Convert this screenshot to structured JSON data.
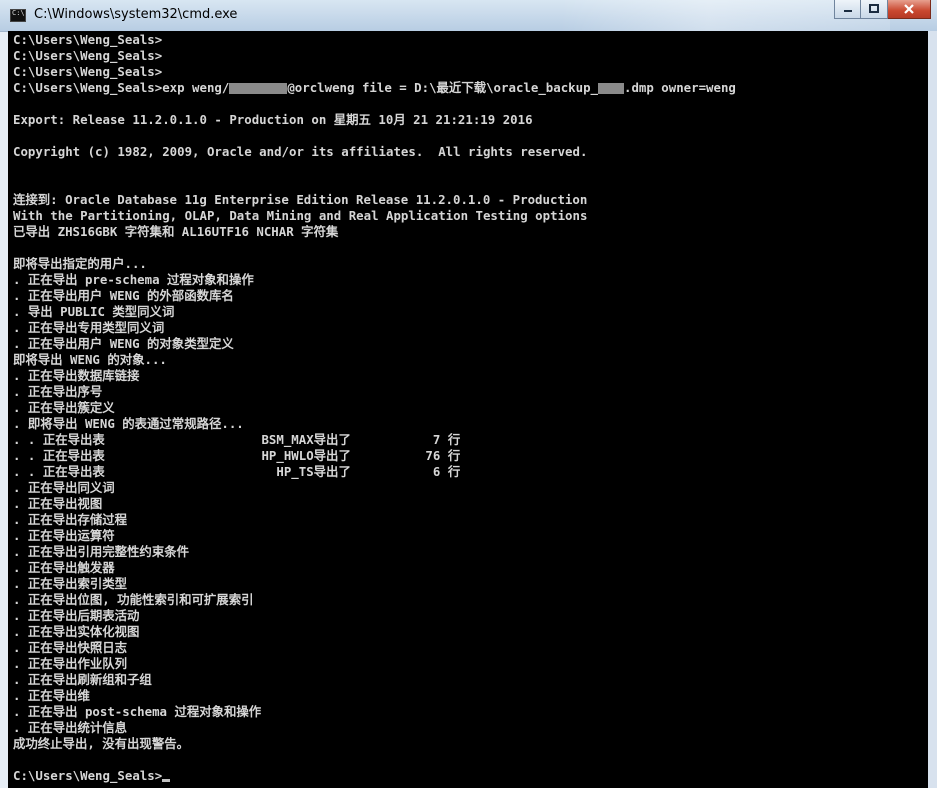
{
  "window": {
    "title": "C:\\Windows\\system32\\cmd.exe",
    "controls": {
      "minimize_icon": "minimize-icon",
      "maximize_icon": "maximize-icon",
      "close_icon": "close-icon"
    }
  },
  "console": {
    "prompt": "C:\\Users\\Weng_Seals>",
    "lines": [
      "C:\\Users\\Weng_Seals>",
      "C:\\Users\\Weng_Seals>",
      "C:\\Users\\Weng_Seals>",
      "C:\\Users\\Weng_Seals>exp weng/",
      "",
      "Export: Release 11.2.0.1.0 - Production on 星期五 10月 21 21:21:19 2016",
      "",
      "Copyright (c) 1982, 2009, Oracle and/or its affiliates.  All rights reserved.",
      "",
      "",
      "连接到: Oracle Database 11g Enterprise Edition Release 11.2.0.1.0 - Production",
      "With the Partitioning, OLAP, Data Mining and Real Application Testing options",
      "已导出 ZHS16GBK 字符集和 AL16UTF16 NCHAR 字符集",
      "",
      "即将导出指定的用户...",
      ". 正在导出 pre-schema 过程对象和操作",
      ". 正在导出用户 WENG 的外部函数库名",
      ". 导出 PUBLIC 类型同义词",
      ". 正在导出专用类型同义词",
      ". 正在导出用户 WENG 的对象类型定义",
      "即将导出 WENG 的对象...",
      ". 正在导出数据库链接",
      ". 正在导出序号",
      ". 正在导出簇定义",
      ". 即将导出 WENG 的表通过常规路径...",
      ". . 正在导出表                     BSM_MAX导出了           7 行",
      ". . 正在导出表                     HP_HWLO导出了          76 行",
      ". . 正在导出表                       HP_TS导出了           6 行",
      ". 正在导出同义词",
      ". 正在导出视图",
      ". 正在导出存储过程",
      ". 正在导出运算符",
      ". 正在导出引用完整性约束条件",
      ". 正在导出触发器",
      ". 正在导出索引类型",
      ". 正在导出位图, 功能性索引和可扩展索引",
      ". 正在导出后期表活动",
      ". 正在导出实体化视图",
      ". 正在导出快照日志",
      ". 正在导出作业队列",
      ". 正在导出刷新组和子组",
      ". 正在导出维",
      ". 正在导出 post-schema 过程对象和操作",
      ". 正在导出统计信息",
      "成功终止导出, 没有出现警告。",
      "",
      "C:\\Users\\Weng_Seals>"
    ],
    "exp_command_tail_a": "@orclweng file = D:\\最近下载\\oracle_backup_",
    "exp_command_tail_b": ".dmp owner=weng"
  },
  "colors": {
    "console_bg": "#000000",
    "console_text": "#c0c0c0",
    "titlebar": "#c6d8ea",
    "close_button": "#c9472f"
  }
}
